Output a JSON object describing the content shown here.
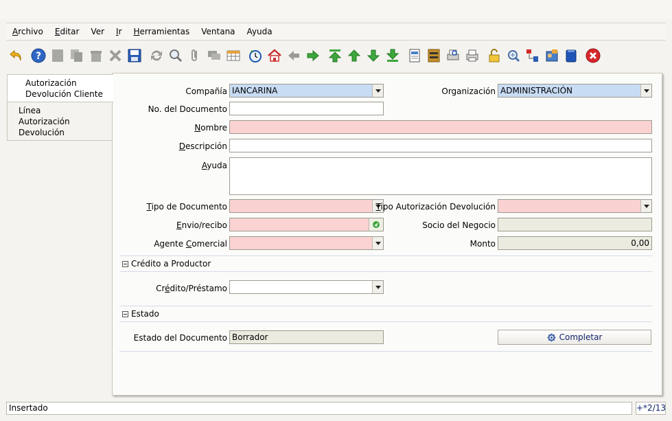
{
  "menu": {
    "items": [
      {
        "key": "A",
        "rest": "rchivo"
      },
      {
        "key": "E",
        "rest": "ditar"
      },
      {
        "key": "",
        "rest": "Ver"
      },
      {
        "key": "I",
        "rest": "r"
      },
      {
        "key": "H",
        "rest": "erramientas"
      },
      {
        "key": "",
        "rest": "Ventana"
      },
      {
        "key": "",
        "rest": "Ayuda"
      }
    ]
  },
  "toolbar": {
    "icons": [
      "undo-icon",
      "help-icon",
      "new-record-icon",
      "copy-record-icon",
      "delete-icon",
      "delete-selection-icon",
      "save-icon",
      "refresh-icon",
      "find-icon",
      "attachment-icon",
      "chat-icon",
      "grid-toggle-icon",
      "history-icon",
      "home-icon",
      "back-icon",
      "forward-icon",
      "first-record-icon",
      "previous-record-icon",
      "next-record-icon",
      "last-record-icon",
      "report-icon",
      "archive-icon",
      "print-preview-icon",
      "print-icon",
      "lock-icon",
      "zoom-across-icon",
      "active-workflows-icon",
      "requests-icon",
      "product-info-icon",
      "exit-icon"
    ]
  },
  "tabs": {
    "header": "Autorización Devolución Cliente",
    "header_line1": "Autorización",
    "header_line2": "Devolución Cliente",
    "sub_line1": "Línea",
    "sub_line2": "Autorización Devolución"
  },
  "form": {
    "company": {
      "label": "Compañía",
      "value": "IANCARINA"
    },
    "org": {
      "label": "Organización",
      "value": "ADMINISTRACIÓN"
    },
    "docno": {
      "label": "No. del Documento",
      "value": ""
    },
    "name": {
      "label_u": "N",
      "label_rest": "ombre",
      "value": ""
    },
    "description": {
      "label_u": "D",
      "label_rest": "escripción",
      "value": ""
    },
    "help": {
      "label_u": "A",
      "label_rest": "yuda",
      "value": ""
    },
    "doctype": {
      "label_u": "T",
      "label_rest": "ipo de Documento",
      "value": ""
    },
    "ratype": {
      "label_u": "T",
      "label_rest": "ipo Autorización Devolución",
      "value": ""
    },
    "shipment": {
      "label_u": "E",
      "label_rest": "nvio/recibo",
      "value": ""
    },
    "bpartner": {
      "label": "Socio del Negocio",
      "value": ""
    },
    "salesrep": {
      "label_pre": "Agente ",
      "label_u": "C",
      "label_rest": "omercial",
      "value": ""
    },
    "amount": {
      "label": "Monto",
      "value": "0,00"
    },
    "section_credit": "Crédito a Productor",
    "credit": {
      "label_pre": "Cr",
      "label_u": "é",
      "label_rest": "dito/Préstamo",
      "value": ""
    },
    "section_status": "Estado",
    "docstatus": {
      "label": "Estado del Documento",
      "value": "Borrador"
    },
    "complete_button": "Completar"
  },
  "status": {
    "message": "Insertado",
    "record": "+*2/13"
  },
  "colors": {
    "mandatory": "#fad2d2",
    "readonly": "#ecebe0",
    "selected": "#c8dcf4",
    "accent": "#10226b"
  }
}
